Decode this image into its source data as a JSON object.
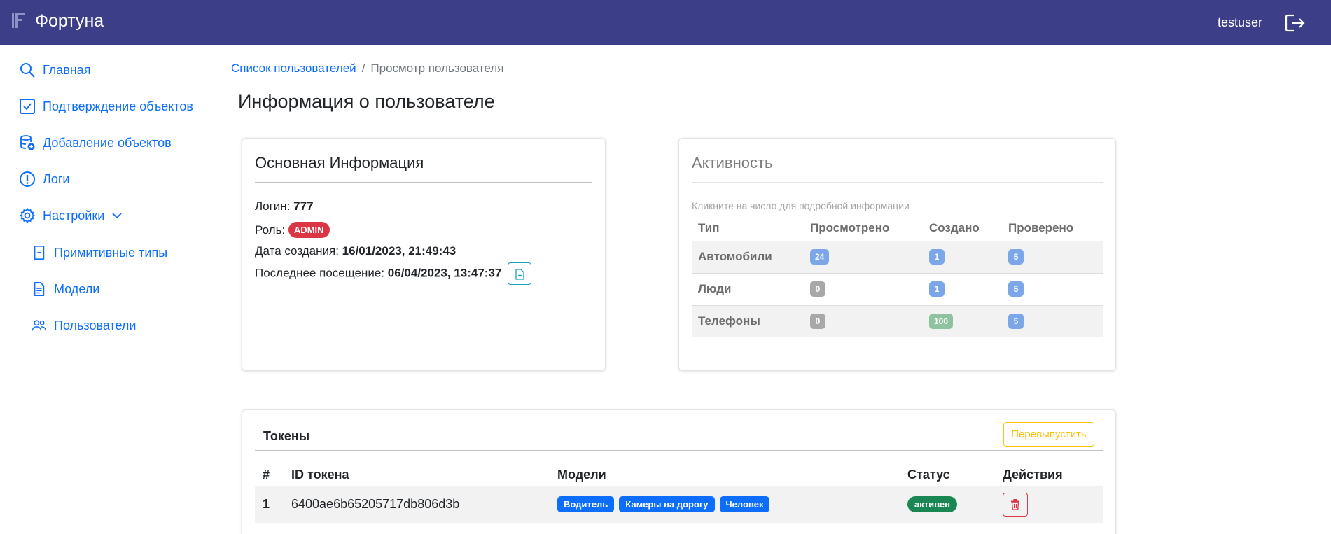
{
  "app": {
    "title": "Фортуна",
    "username": "testuser"
  },
  "sidebar": {
    "items": [
      {
        "label": "Главная",
        "icon": "search-icon"
      },
      {
        "label": "Подтверждение объектов",
        "icon": "check-square-icon"
      },
      {
        "label": "Добавление объектов",
        "icon": "database-add-icon"
      },
      {
        "label": "Логи",
        "icon": "exclamation-circle-icon"
      },
      {
        "label": "Настройки",
        "icon": "gear-icon",
        "expanded": true
      }
    ],
    "sub_items": [
      {
        "label": "Примитивные типы",
        "icon": "file-minus-icon"
      },
      {
        "label": "Модели",
        "icon": "file-text-icon"
      },
      {
        "label": "Пользователи",
        "icon": "people-icon"
      }
    ]
  },
  "breadcrumb": {
    "link": "Список пользователей",
    "separator": "/",
    "current": "Просмотр пользователя"
  },
  "page_title": "Информация о пользователе",
  "info_card": {
    "title": "Основная Информация",
    "login_label": "Логин:",
    "login_value": "777",
    "role_label": "Роль:",
    "role_value": "ADMIN",
    "created_label": "Дата создания:",
    "created_value": "16/01/2023, 21:49:43",
    "last_visit_label": "Последнее посещение:",
    "last_visit_value": "06/04/2023, 13:47:37"
  },
  "activity_card": {
    "title": "Активность",
    "hint": "Кликните на число для подробной информации",
    "headers": [
      "Тип",
      "Просмотрено",
      "Создано",
      "Проверено"
    ],
    "rows": [
      {
        "type": "Автомобили",
        "viewed": "24",
        "created": "1",
        "checked": "5"
      },
      {
        "type": "Люди",
        "viewed": "0",
        "created": "1",
        "checked": "5"
      },
      {
        "type": "Телефоны",
        "viewed": "0",
        "created": "100",
        "checked": "5"
      }
    ]
  },
  "tokens_card": {
    "title": "Токены",
    "reissue_label": "Перевыпустить",
    "headers": [
      "#",
      "ID токена",
      "Модели",
      "Статус",
      "Действия"
    ],
    "rows": [
      {
        "index": "1",
        "token_id": "6400ae6b65205717db806d3b",
        "models": [
          "Водитель",
          "Камеры на дорогу",
          "Человек"
        ],
        "status": "активен"
      }
    ]
  },
  "colors": {
    "header_bg": "#3c3e87",
    "link": "#0d6efd",
    "admin_badge": "#dc3545",
    "status_active": "#198754",
    "viewed_badge_nonzero": "#7ba7e8",
    "zero_badge": "#a8a8a8",
    "created_badge_large": "#8fc29e",
    "reissue_outline": "#ffc107"
  }
}
